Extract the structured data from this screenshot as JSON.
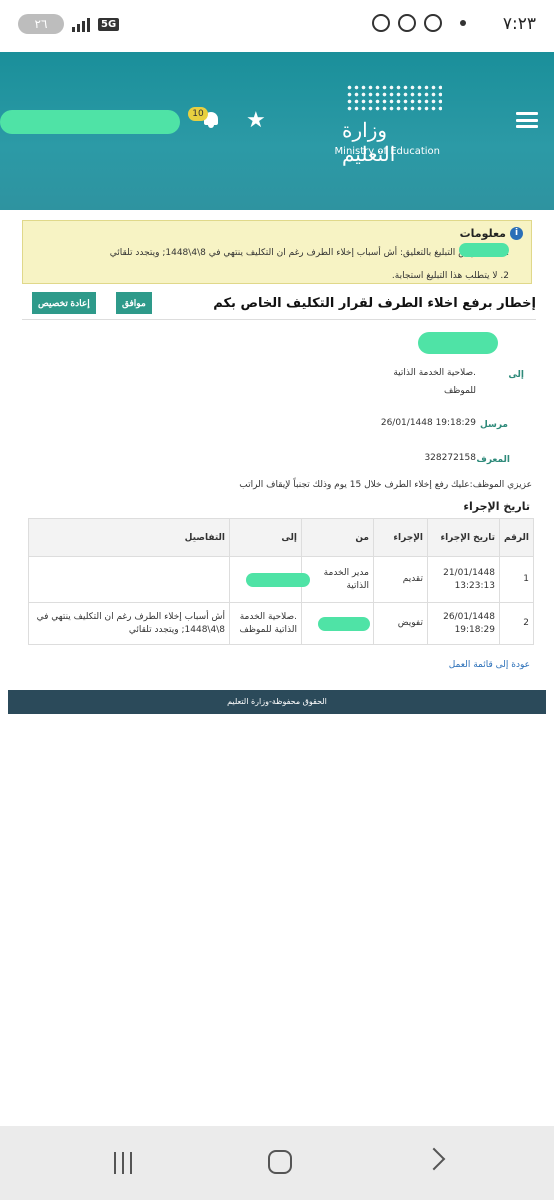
{
  "status_bar": {
    "time": "٧:٢٣",
    "battery": "٢٦",
    "network": "5G"
  },
  "header": {
    "logo_ar": "وزارة التعليم",
    "logo_en": "Ministry of Education",
    "notification_count": "10"
  },
  "info": {
    "title": "معلومات",
    "line1": "1. ... بتفويض التبليغ بالتعليق: أش أسباب إخلاء الطرف رغم ان التكليف ينتهي في 8\\4\\1448; ويتجدد تلقائي",
    "line2": "2. لا يتطلب هذا التبليغ استجابة."
  },
  "task": {
    "title": "إخطار برفع اخلاء الطرف لقرار التكليف الخاص بكم",
    "approve_label": "موافق",
    "reassign_label": "إعادة تخصيص"
  },
  "fields": {
    "to_label": "إلى",
    "to_value_line1": ".صلاحية الخدمة الذاتية",
    "to_value_line2": "للموظف",
    "sent_label": "مرسل",
    "sent_value": "26/01/1448 19:18:29",
    "id_label": "المعرف",
    "id_value": "328272158"
  },
  "message": "عزيزي الموظف:عليك رفع إخلاء الطرف خلال 15 يوم وذلك تجنباً لإيقاف الراتب",
  "history": {
    "title": "تاريخ الإجراء",
    "columns": [
      "الرقم",
      "تاريخ الإجراء",
      "الإجراء",
      "من",
      "إلى",
      "التفاصيل"
    ],
    "rows": [
      {
        "num": "1",
        "date": "21/01/1448",
        "time": "13:23:13",
        "action": "تقديم",
        "from": "مدير الخدمة الذاتية",
        "to": "",
        "details": ""
      },
      {
        "num": "2",
        "date": "26/01/1448",
        "time": "19:18:29",
        "action": "تفويض",
        "from": "",
        "to": ".صلاحية الخدمة الذاتية للموظف",
        "details": "أش أسباب إخلاء الطرف رغم ان التكليف ينتهي في 8\\4\\1448; ويتجدد تلقائي"
      }
    ]
  },
  "back_link": "عودة إلى قائمة العمل",
  "footer": "الحقوق محفوظة-وزارة التعليم",
  "colors": {
    "header_teal": "#2c9aa6",
    "button_green": "#2e9a8a",
    "info_yellow": "#f7f3c4",
    "footer_dark": "#2b4a5a",
    "redaction": "#4fe3a6"
  }
}
